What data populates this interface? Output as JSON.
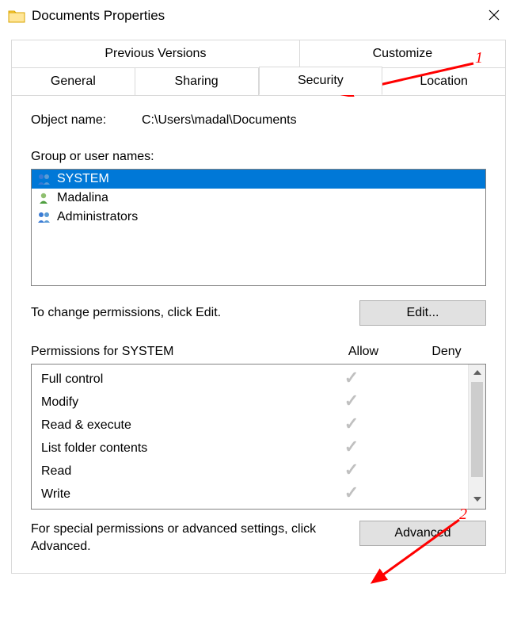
{
  "window": {
    "title": "Documents Properties"
  },
  "tabs": {
    "row1": [
      {
        "label": "Previous Versions"
      },
      {
        "label": "Customize"
      }
    ],
    "row2": [
      {
        "label": "General"
      },
      {
        "label": "Sharing"
      },
      {
        "label": "Security",
        "active": true
      },
      {
        "label": "Location"
      }
    ]
  },
  "object": {
    "label": "Object name:",
    "value": "C:\\Users\\madal\\Documents"
  },
  "groups_label": "Group or user names:",
  "users": [
    {
      "name": "SYSTEM",
      "icon": "group",
      "selected": true
    },
    {
      "name": "Madalina",
      "icon": "user",
      "selected": false
    },
    {
      "name": "Administrators",
      "icon": "group",
      "selected": false
    }
  ],
  "edit_hint": "To change permissions, click Edit.",
  "edit_button": "Edit...",
  "perm_header": {
    "name": "Permissions for SYSTEM",
    "allow": "Allow",
    "deny": "Deny"
  },
  "permissions": [
    {
      "name": "Full control",
      "allow": true,
      "deny": false
    },
    {
      "name": "Modify",
      "allow": true,
      "deny": false
    },
    {
      "name": "Read & execute",
      "allow": true,
      "deny": false
    },
    {
      "name": "List folder contents",
      "allow": true,
      "deny": false
    },
    {
      "name": "Read",
      "allow": true,
      "deny": false
    },
    {
      "name": "Write",
      "allow": true,
      "deny": false
    }
  ],
  "advanced_hint": "For special permissions or advanced settings, click Advanced.",
  "advanced_button": "Advanced",
  "annotations": {
    "num1": "1",
    "num2": "2"
  }
}
